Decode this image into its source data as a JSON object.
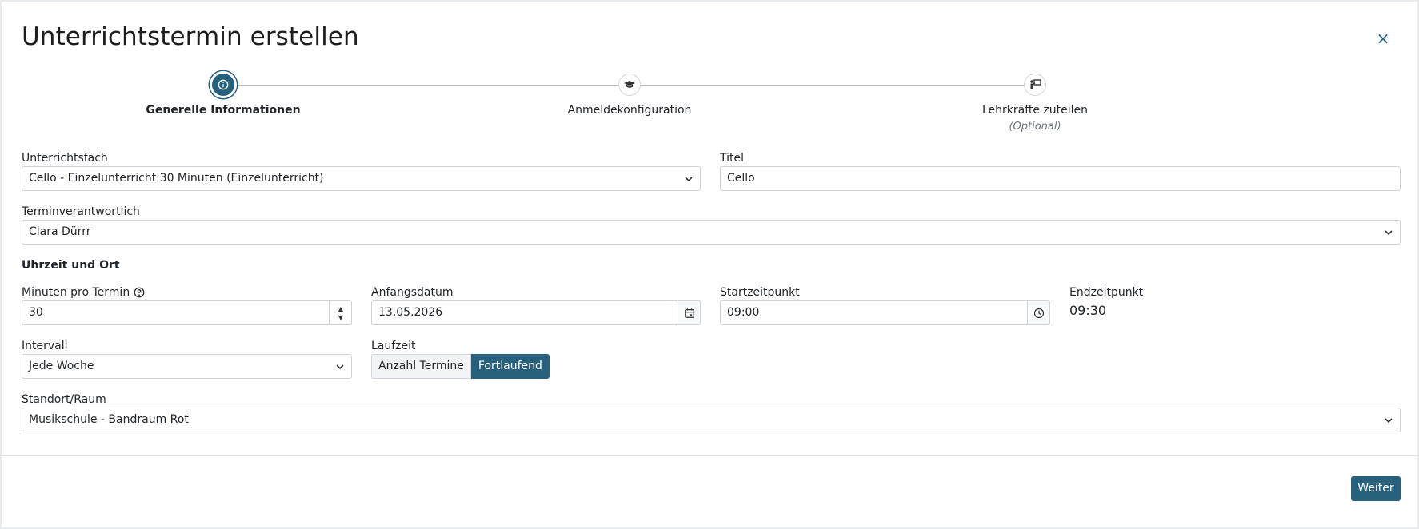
{
  "dialog": {
    "title": "Unterrichtstermin erstellen",
    "close_glyph": "×"
  },
  "stepper": {
    "steps": [
      {
        "label": "Generelle Informationen",
        "icon": "info-icon",
        "active": true
      },
      {
        "label": "Anmeldekonfiguration",
        "icon": "graduation-cap-icon",
        "active": false
      },
      {
        "label": "Lehrkräfte zuteilen",
        "sublabel": "(Optional)",
        "icon": "teacher-board-icon",
        "active": false
      }
    ]
  },
  "form": {
    "subject": {
      "label": "Unterrichtsfach",
      "value": "Cello - Einzelunterricht 30 Minuten (Einzelunterricht)"
    },
    "title": {
      "label": "Titel",
      "value": "Cello"
    },
    "responsible": {
      "label": "Terminverantwortlich",
      "value": "Clara Dürrr"
    },
    "section_time": "Uhrzeit und Ort",
    "minutes": {
      "label": "Minuten pro Termin",
      "value": "30"
    },
    "start_date": {
      "label": "Anfangsdatum",
      "value": "13.05.2026"
    },
    "start_time": {
      "label": "Startzeitpunkt",
      "value": "09:00"
    },
    "end_time": {
      "label": "Endzeitpunkt",
      "value": "09:30"
    },
    "interval": {
      "label": "Intervall",
      "value": "Jede Woche"
    },
    "duration": {
      "label": "Laufzeit",
      "option_count": "Anzahl Termine",
      "option_ongoing": "Fortlaufend",
      "selected": "Fortlaufend"
    },
    "location": {
      "label": "Standort/Raum",
      "value": "Musikschule - Bandraum Rot"
    }
  },
  "footer": {
    "next_label": "Weiter"
  },
  "colors": {
    "accent": "#27617e"
  }
}
